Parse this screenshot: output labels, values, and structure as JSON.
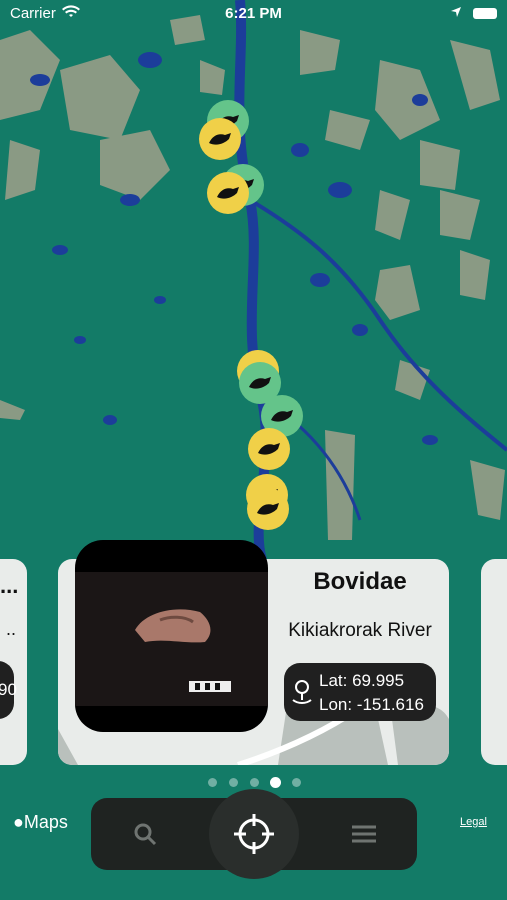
{
  "status_bar": {
    "carrier": "Carrier",
    "time": "6:21 PM"
  },
  "map": {
    "attribution_logo": "Maps",
    "legal_link": "Legal",
    "pins": [
      {
        "color": "green"
      },
      {
        "color": "yellow"
      },
      {
        "color": "green"
      },
      {
        "color": "yellow"
      },
      {
        "color": "yellow"
      },
      {
        "color": "green"
      },
      {
        "color": "green"
      },
      {
        "color": "yellow"
      },
      {
        "color": "yellow"
      },
      {
        "color": "yellow"
      }
    ]
  },
  "left_card": {
    "line1": "...",
    "line2": "..",
    "badge": "90"
  },
  "main_card": {
    "title": "Bovidae",
    "location": "Kikiakrorak River",
    "lat_label": "Lat: 69.995",
    "lon_label": "Lon: -151.616"
  },
  "pager": {
    "count": 5,
    "active_index": 3
  },
  "toolbar": {
    "search_icon": "search-icon",
    "locate_icon": "crosshair-icon",
    "menu_icon": "menu-icon"
  },
  "colors": {
    "water": "#137b67",
    "land": "#8a9a84",
    "lake": "#1c3d9a",
    "pin_green": "#64c48a",
    "pin_yellow": "#f0d048"
  }
}
